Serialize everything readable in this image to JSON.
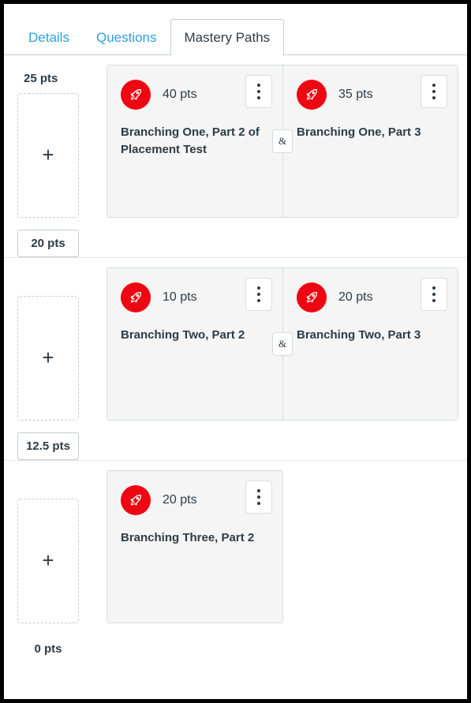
{
  "tabs": [
    {
      "label": "Details",
      "active": false
    },
    {
      "label": "Questions",
      "active": false
    },
    {
      "label": "Mastery Paths",
      "active": true
    }
  ],
  "icons": {
    "rocket": "rocket-icon",
    "kebab": "more-options-icon",
    "add": "+"
  },
  "colors": {
    "accent_red": "#ee0612",
    "link_blue": "#2a9fe3",
    "text_dark": "#2d3b45",
    "card_bg": "#f5f5f5",
    "border": "#c7cdd1"
  },
  "connector_label": "&",
  "sections": [
    {
      "total_points": "25 pts",
      "has_total_label": true,
      "add_placeholder": "+",
      "score_value": "20 pts",
      "score_boxed": true,
      "cards": [
        {
          "points": "40 pts",
          "title": "Branching One, Part 2 of Placement Test"
        },
        {
          "points": "35 pts",
          "title": "Branching One, Part 3"
        }
      ]
    },
    {
      "total_points": "",
      "has_total_label": false,
      "add_placeholder": "+",
      "score_value": "12.5 pts",
      "score_boxed": true,
      "cards": [
        {
          "points": "10 pts",
          "title": "Branching Two, Part 2"
        },
        {
          "points": "20 pts",
          "title": "Branching Two, Part 3"
        }
      ]
    },
    {
      "total_points": "",
      "has_total_label": false,
      "add_placeholder": "+",
      "score_value": "0 pts",
      "score_boxed": false,
      "cards": [
        {
          "points": "20 pts",
          "title": "Branching Three, Part 2"
        }
      ]
    }
  ]
}
